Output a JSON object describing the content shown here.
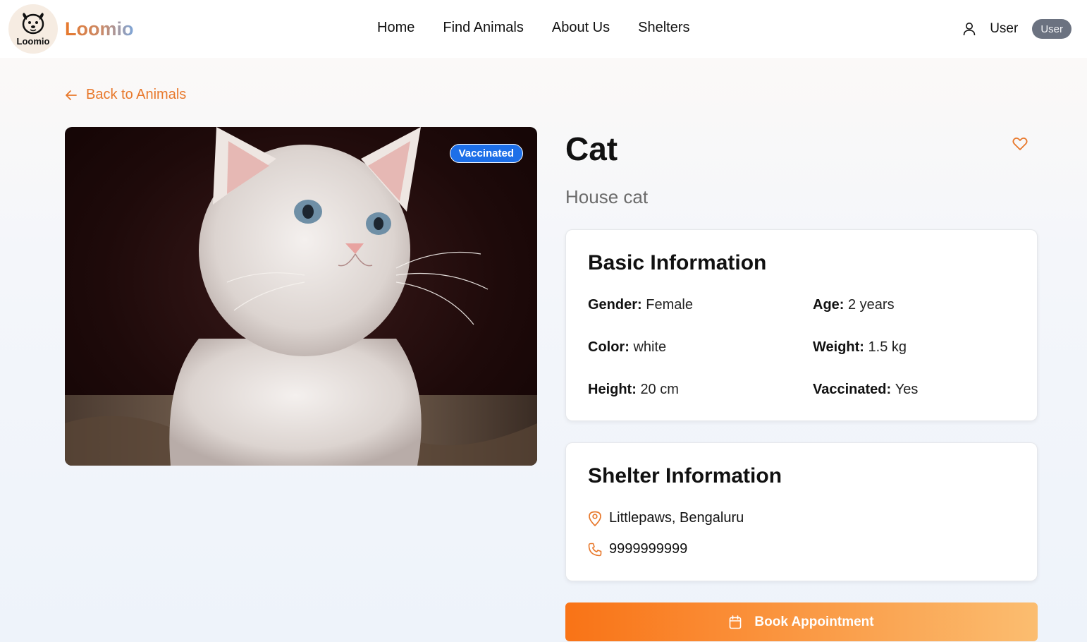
{
  "brand": {
    "name": "Loomio",
    "logo_text": "Loomio"
  },
  "nav": {
    "links": [
      "Home",
      "Find Animals",
      "About Us",
      "Shelters"
    ]
  },
  "user": {
    "name": "User",
    "role": "User"
  },
  "back_label": "Back to Animals",
  "animal": {
    "name": "Cat",
    "breed": "House cat",
    "badge": "Vaccinated",
    "image_alt": "white kitten"
  },
  "basic_info": {
    "heading": "Basic Information",
    "fields": [
      {
        "label": "Gender:",
        "value": "Female"
      },
      {
        "label": "Age:",
        "value": "2 years"
      },
      {
        "label": "Color:",
        "value": "white"
      },
      {
        "label": "Weight:",
        "value": "1.5 kg"
      },
      {
        "label": "Height:",
        "value": "20 cm"
      },
      {
        "label": "Vaccinated:",
        "value": "Yes"
      }
    ]
  },
  "shelter_info": {
    "heading": "Shelter Information",
    "location": "Littlepaws, Bengaluru",
    "phone": "9999999999"
  },
  "book_label": "Book Appointment",
  "colors": {
    "accent": "#e8782b",
    "badge_blue": "#1d6fe8"
  }
}
